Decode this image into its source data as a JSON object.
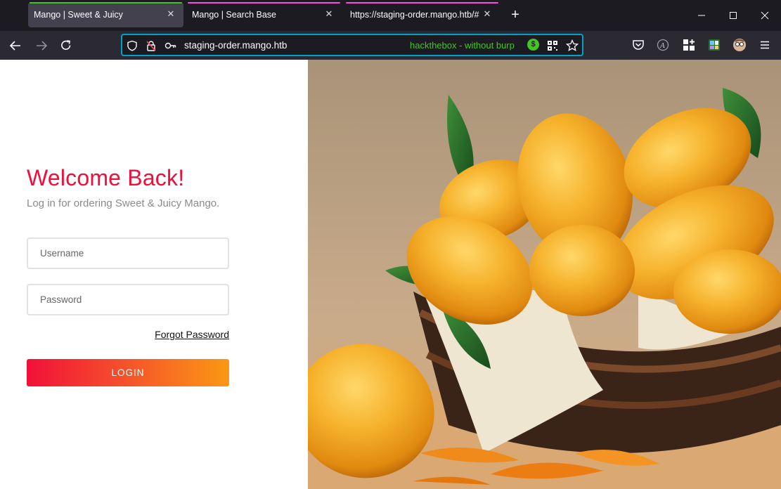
{
  "browser": {
    "tabs": [
      {
        "title": "Mango | Sweet & Juicy",
        "active": true,
        "context_color": "#44c425"
      },
      {
        "title": "Mango | Search Base",
        "active": false,
        "context_color": "#ff4bda"
      },
      {
        "title": "https://staging-order.mango.htb/#",
        "active": false,
        "context_color": "#ff4bda"
      }
    ],
    "new_tab_icon": "plus-icon",
    "window_controls": [
      "minimize-icon",
      "maximize-icon",
      "close-icon"
    ],
    "nav_icons": [
      "back-arrow-icon",
      "forward-arrow-icon",
      "reload-icon"
    ],
    "url": "staging-order.mango.htb",
    "container_label": "hackthebox - without burp",
    "container_badge": "$",
    "accent_color": "#00a3c7",
    "toolbar_icons": [
      "pocket-icon",
      "extension-icon",
      "addon-grid-icon",
      "color-extension-icon",
      "profile-avatar-icon",
      "menu-icon"
    ]
  },
  "login": {
    "heading": "Welcome Back!",
    "subtitle": "Log in for ordering Sweet & Juicy Mango.",
    "username_placeholder": "Username",
    "username_value": "",
    "password_placeholder": "Password",
    "password_value": "",
    "forgot_label": "Forgot Password",
    "login_label": "LOGIN",
    "heading_color": "#f20d3a",
    "button_gradient": [
      "#f2103a",
      "#fb9813"
    ]
  },
  "photo": {
    "subject": "mango-basket-photo"
  }
}
